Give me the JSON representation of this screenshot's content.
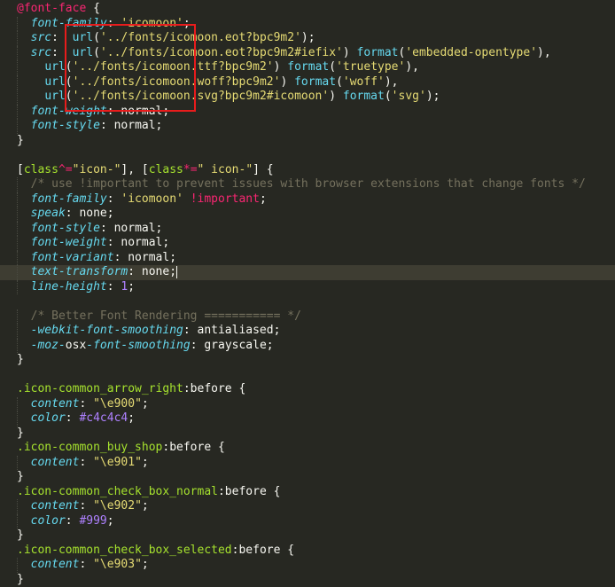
{
  "editor": {
    "colors": {
      "background": "#272822",
      "annotation_box": "#e81c1c"
    },
    "lines": [
      [
        {
          "c": "at",
          "t": "@font-face"
        },
        {
          "c": "plain",
          "t": " {"
        }
      ],
      [
        {
          "c": "plain",
          "t": "  "
        },
        {
          "c": "prop",
          "t": "font-family"
        },
        {
          "c": "plain",
          "t": ": "
        },
        {
          "c": "str",
          "t": "'icomoon'"
        },
        {
          "c": "plain",
          "t": ";"
        }
      ],
      [
        {
          "c": "plain",
          "t": "  "
        },
        {
          "c": "prop",
          "t": "src"
        },
        {
          "c": "plain",
          "t": ":  "
        },
        {
          "c": "fn",
          "t": "url"
        },
        {
          "c": "plain",
          "t": "("
        },
        {
          "c": "str",
          "t": "'../fonts/icomoon.eot?bpc9m2'"
        },
        {
          "c": "plain",
          "t": ");"
        }
      ],
      [
        {
          "c": "plain",
          "t": "  "
        },
        {
          "c": "prop",
          "t": "src"
        },
        {
          "c": "plain",
          "t": ":  "
        },
        {
          "c": "fn",
          "t": "url"
        },
        {
          "c": "plain",
          "t": "("
        },
        {
          "c": "str",
          "t": "'../fonts/icomoon.eot?bpc9m2#iefix'"
        },
        {
          "c": "plain",
          "t": ") "
        },
        {
          "c": "fn",
          "t": "format"
        },
        {
          "c": "plain",
          "t": "("
        },
        {
          "c": "str",
          "t": "'embedded-opentype'"
        },
        {
          "c": "plain",
          "t": "),"
        }
      ],
      [
        {
          "c": "plain",
          "t": "    "
        },
        {
          "c": "fn",
          "t": "url"
        },
        {
          "c": "plain",
          "t": "("
        },
        {
          "c": "str",
          "t": "'../fonts/icomoon.ttf?bpc9m2'"
        },
        {
          "c": "plain",
          "t": ") "
        },
        {
          "c": "fn",
          "t": "format"
        },
        {
          "c": "plain",
          "t": "("
        },
        {
          "c": "str",
          "t": "'truetype'"
        },
        {
          "c": "plain",
          "t": "),"
        }
      ],
      [
        {
          "c": "plain",
          "t": "    "
        },
        {
          "c": "fn",
          "t": "url"
        },
        {
          "c": "plain",
          "t": "("
        },
        {
          "c": "str",
          "t": "'../fonts/icomoon.woff?bpc9m2'"
        },
        {
          "c": "plain",
          "t": ") "
        },
        {
          "c": "fn",
          "t": "format"
        },
        {
          "c": "plain",
          "t": "("
        },
        {
          "c": "str",
          "t": "'woff'"
        },
        {
          "c": "plain",
          "t": "),"
        }
      ],
      [
        {
          "c": "plain",
          "t": "    "
        },
        {
          "c": "fn",
          "t": "url"
        },
        {
          "c": "plain",
          "t": "("
        },
        {
          "c": "str",
          "t": "'../fonts/icomoon.svg?bpc9m2#icomoon'"
        },
        {
          "c": "plain",
          "t": ") "
        },
        {
          "c": "fn",
          "t": "format"
        },
        {
          "c": "plain",
          "t": "("
        },
        {
          "c": "str",
          "t": "'svg'"
        },
        {
          "c": "plain",
          "t": ");"
        }
      ],
      [
        {
          "c": "plain",
          "t": "  "
        },
        {
          "c": "prop",
          "t": "font-weight"
        },
        {
          "c": "plain",
          "t": ": "
        },
        {
          "c": "plain",
          "t": "normal;"
        }
      ],
      [
        {
          "c": "plain",
          "t": "  "
        },
        {
          "c": "prop",
          "t": "font-style"
        },
        {
          "c": "plain",
          "t": ": "
        },
        {
          "c": "plain",
          "t": "normal;"
        }
      ],
      [
        {
          "c": "plain",
          "t": "}"
        }
      ],
      [],
      [
        {
          "c": "plain",
          "t": "["
        },
        {
          "c": "attr",
          "t": "class"
        },
        {
          "c": "op",
          "t": "^="
        },
        {
          "c": "str",
          "t": "\"icon-\""
        },
        {
          "c": "plain",
          "t": "], ["
        },
        {
          "c": "attr",
          "t": "class"
        },
        {
          "c": "op",
          "t": "*="
        },
        {
          "c": "str",
          "t": "\" icon-\""
        },
        {
          "c": "plain",
          "t": "] {"
        }
      ],
      [
        {
          "c": "plain",
          "t": "  "
        },
        {
          "c": "cmt",
          "t": "/* use !important to prevent issues with browser extensions that change fonts */"
        }
      ],
      [
        {
          "c": "plain",
          "t": "  "
        },
        {
          "c": "prop",
          "t": "font-family"
        },
        {
          "c": "plain",
          "t": ": "
        },
        {
          "c": "str",
          "t": "'icomoon'"
        },
        {
          "c": "plain",
          "t": " "
        },
        {
          "c": "imp",
          "t": "!important"
        },
        {
          "c": "plain",
          "t": ";"
        }
      ],
      [
        {
          "c": "plain",
          "t": "  "
        },
        {
          "c": "prop",
          "t": "speak"
        },
        {
          "c": "plain",
          "t": ": none;"
        }
      ],
      [
        {
          "c": "plain",
          "t": "  "
        },
        {
          "c": "prop",
          "t": "font-style"
        },
        {
          "c": "plain",
          "t": ": normal;"
        }
      ],
      [
        {
          "c": "plain",
          "t": "  "
        },
        {
          "c": "prop",
          "t": "font-weight"
        },
        {
          "c": "plain",
          "t": ": normal;"
        }
      ],
      [
        {
          "c": "plain",
          "t": "  "
        },
        {
          "c": "prop",
          "t": "font-variant"
        },
        {
          "c": "plain",
          "t": ": normal;"
        }
      ],
      [
        {
          "c": "plain",
          "t": "  "
        },
        {
          "c": "prop",
          "t": "text-transform"
        },
        {
          "c": "plain",
          "t": ": none;"
        }
      ],
      [
        {
          "c": "plain",
          "t": "  "
        },
        {
          "c": "prop",
          "t": "line-height"
        },
        {
          "c": "plain",
          "t": ": "
        },
        {
          "c": "num",
          "t": "1"
        },
        {
          "c": "plain",
          "t": ";"
        }
      ],
      [],
      [
        {
          "c": "plain",
          "t": "  "
        },
        {
          "c": "cmt",
          "t": "/* Better Font Rendering =========== */"
        }
      ],
      [
        {
          "c": "plain",
          "t": "  "
        },
        {
          "c": "prop",
          "t": "-webkit-font-smoothing"
        },
        {
          "c": "plain",
          "t": ": antialiased;"
        }
      ],
      [
        {
          "c": "plain",
          "t": "  "
        },
        {
          "c": "prop",
          "t": "-moz-"
        },
        {
          "c": "plain",
          "t": "osx"
        },
        {
          "c": "prop",
          "t": "-font-smoothing"
        },
        {
          "c": "plain",
          "t": ": grayscale;"
        }
      ],
      [
        {
          "c": "plain",
          "t": "}"
        }
      ],
      [],
      [
        {
          "c": "sel",
          "t": ".icon-common_arrow_right"
        },
        {
          "c": "plain",
          "t": ":before {"
        }
      ],
      [
        {
          "c": "plain",
          "t": "  "
        },
        {
          "c": "prop",
          "t": "content"
        },
        {
          "c": "plain",
          "t": ": "
        },
        {
          "c": "str",
          "t": "\"\\e900\""
        },
        {
          "c": "plain",
          "t": ";"
        }
      ],
      [
        {
          "c": "plain",
          "t": "  "
        },
        {
          "c": "prop",
          "t": "color"
        },
        {
          "c": "plain",
          "t": ": "
        },
        {
          "c": "num",
          "t": "#c4c4c4"
        },
        {
          "c": "plain",
          "t": ";"
        }
      ],
      [
        {
          "c": "plain",
          "t": "}"
        }
      ],
      [
        {
          "c": "sel",
          "t": ".icon-common_buy_shop"
        },
        {
          "c": "plain",
          "t": ":before {"
        }
      ],
      [
        {
          "c": "plain",
          "t": "  "
        },
        {
          "c": "prop",
          "t": "content"
        },
        {
          "c": "plain",
          "t": ": "
        },
        {
          "c": "str",
          "t": "\"\\e901\""
        },
        {
          "c": "plain",
          "t": ";"
        }
      ],
      [
        {
          "c": "plain",
          "t": "}"
        }
      ],
      [
        {
          "c": "sel",
          "t": ".icon-common_check_box_normal"
        },
        {
          "c": "plain",
          "t": ":before {"
        }
      ],
      [
        {
          "c": "plain",
          "t": "  "
        },
        {
          "c": "prop",
          "t": "content"
        },
        {
          "c": "plain",
          "t": ": "
        },
        {
          "c": "str",
          "t": "\"\\e902\""
        },
        {
          "c": "plain",
          "t": ";"
        }
      ],
      [
        {
          "c": "plain",
          "t": "  "
        },
        {
          "c": "prop",
          "t": "color"
        },
        {
          "c": "plain",
          "t": ": "
        },
        {
          "c": "num",
          "t": "#999"
        },
        {
          "c": "plain",
          "t": ";"
        }
      ],
      [
        {
          "c": "plain",
          "t": "}"
        }
      ],
      [
        {
          "c": "sel",
          "t": ".icon-common_check_box_selected"
        },
        {
          "c": "plain",
          "t": ":before {"
        }
      ],
      [
        {
          "c": "plain",
          "t": "  "
        },
        {
          "c": "prop",
          "t": "content"
        },
        {
          "c": "plain",
          "t": ": "
        },
        {
          "c": "str",
          "t": "\"\\e903\""
        },
        {
          "c": "plain",
          "t": ";"
        }
      ],
      [
        {
          "c": "plain",
          "t": "}"
        }
      ]
    ],
    "active_line": 18
  }
}
